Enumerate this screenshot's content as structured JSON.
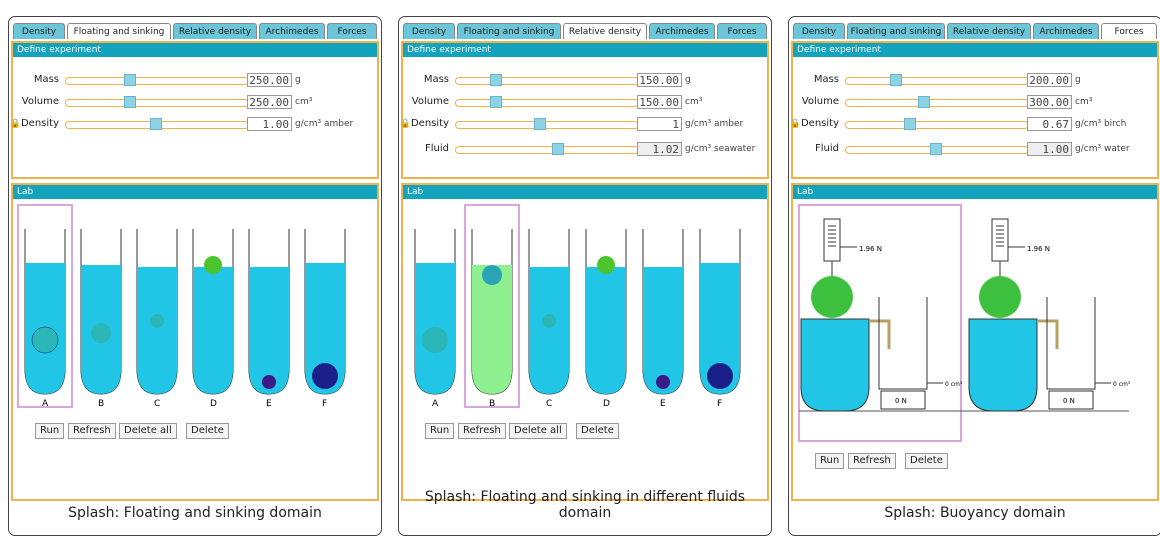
{
  "tabs": [
    "Density",
    "Floating and sinking",
    "Relative density",
    "Archimedes",
    "Forces"
  ],
  "define_title": "Define experiment",
  "lab_title": "Lab",
  "labels": {
    "mass": "Mass",
    "volume": "Volume",
    "density": "Density",
    "fluid": "Fluid"
  },
  "units": {
    "g": "g",
    "cm3": "cm³",
    "gcm3": "g/cm³"
  },
  "panel1": {
    "mass": "250.00",
    "volume": "250.00",
    "density": "1.00",
    "material": "amber",
    "slider_levels": {
      "mass": 0.33,
      "volume": 0.33,
      "density": 0.5
    },
    "tube_labels": [
      "A",
      "B",
      "C",
      "D",
      "E",
      "F"
    ],
    "buttons": {
      "run": "Run",
      "refresh": "Refresh",
      "delete_all": "Delete all",
      "delete": "Delete"
    },
    "caption": "Splash: Floating and sinking domain"
  },
  "panel2": {
    "mass": "150.00",
    "volume": "150.00",
    "density": "1",
    "material": "amber",
    "fluid_density": "1.02",
    "fluid": "seawater",
    "slider_levels": {
      "mass": 0.2,
      "volume": 0.2,
      "density": 0.45,
      "fluid": 0.55
    },
    "tube_labels": [
      "A",
      "B",
      "C",
      "D",
      "E",
      "F"
    ],
    "buttons": {
      "run": "Run",
      "refresh": "Refresh",
      "delete_all": "Delete all",
      "delete": "Delete"
    },
    "caption": "Splash: Floating and sinking in different fluids domain"
  },
  "panel3": {
    "mass": "200.00",
    "volume": "300.00",
    "density": "0.67",
    "material": "birch",
    "fluid_density": "1.00",
    "fluid": "water",
    "slider_levels": {
      "mass": 0.25,
      "volume": 0.4,
      "density": 0.33,
      "fluid": 0.48
    },
    "scale_reading_1": "1.96 N",
    "scale_reading_2": "1.96 N",
    "beaker_volume_1": "0 cm³",
    "beaker_volume_2": "0 cm³",
    "weight_1": "0 N",
    "weight_2": "0 N",
    "buttons": {
      "run": "Run",
      "refresh": "Refresh",
      "delete": "Delete"
    },
    "caption": "Splash: Buoyancy domain"
  },
  "colors": {
    "fluid": "#21c5e5",
    "fluid_green": "#8ef08e",
    "section_border": "#f0b24a",
    "header": "#13a3bd",
    "selection": "#d9a6dd"
  }
}
